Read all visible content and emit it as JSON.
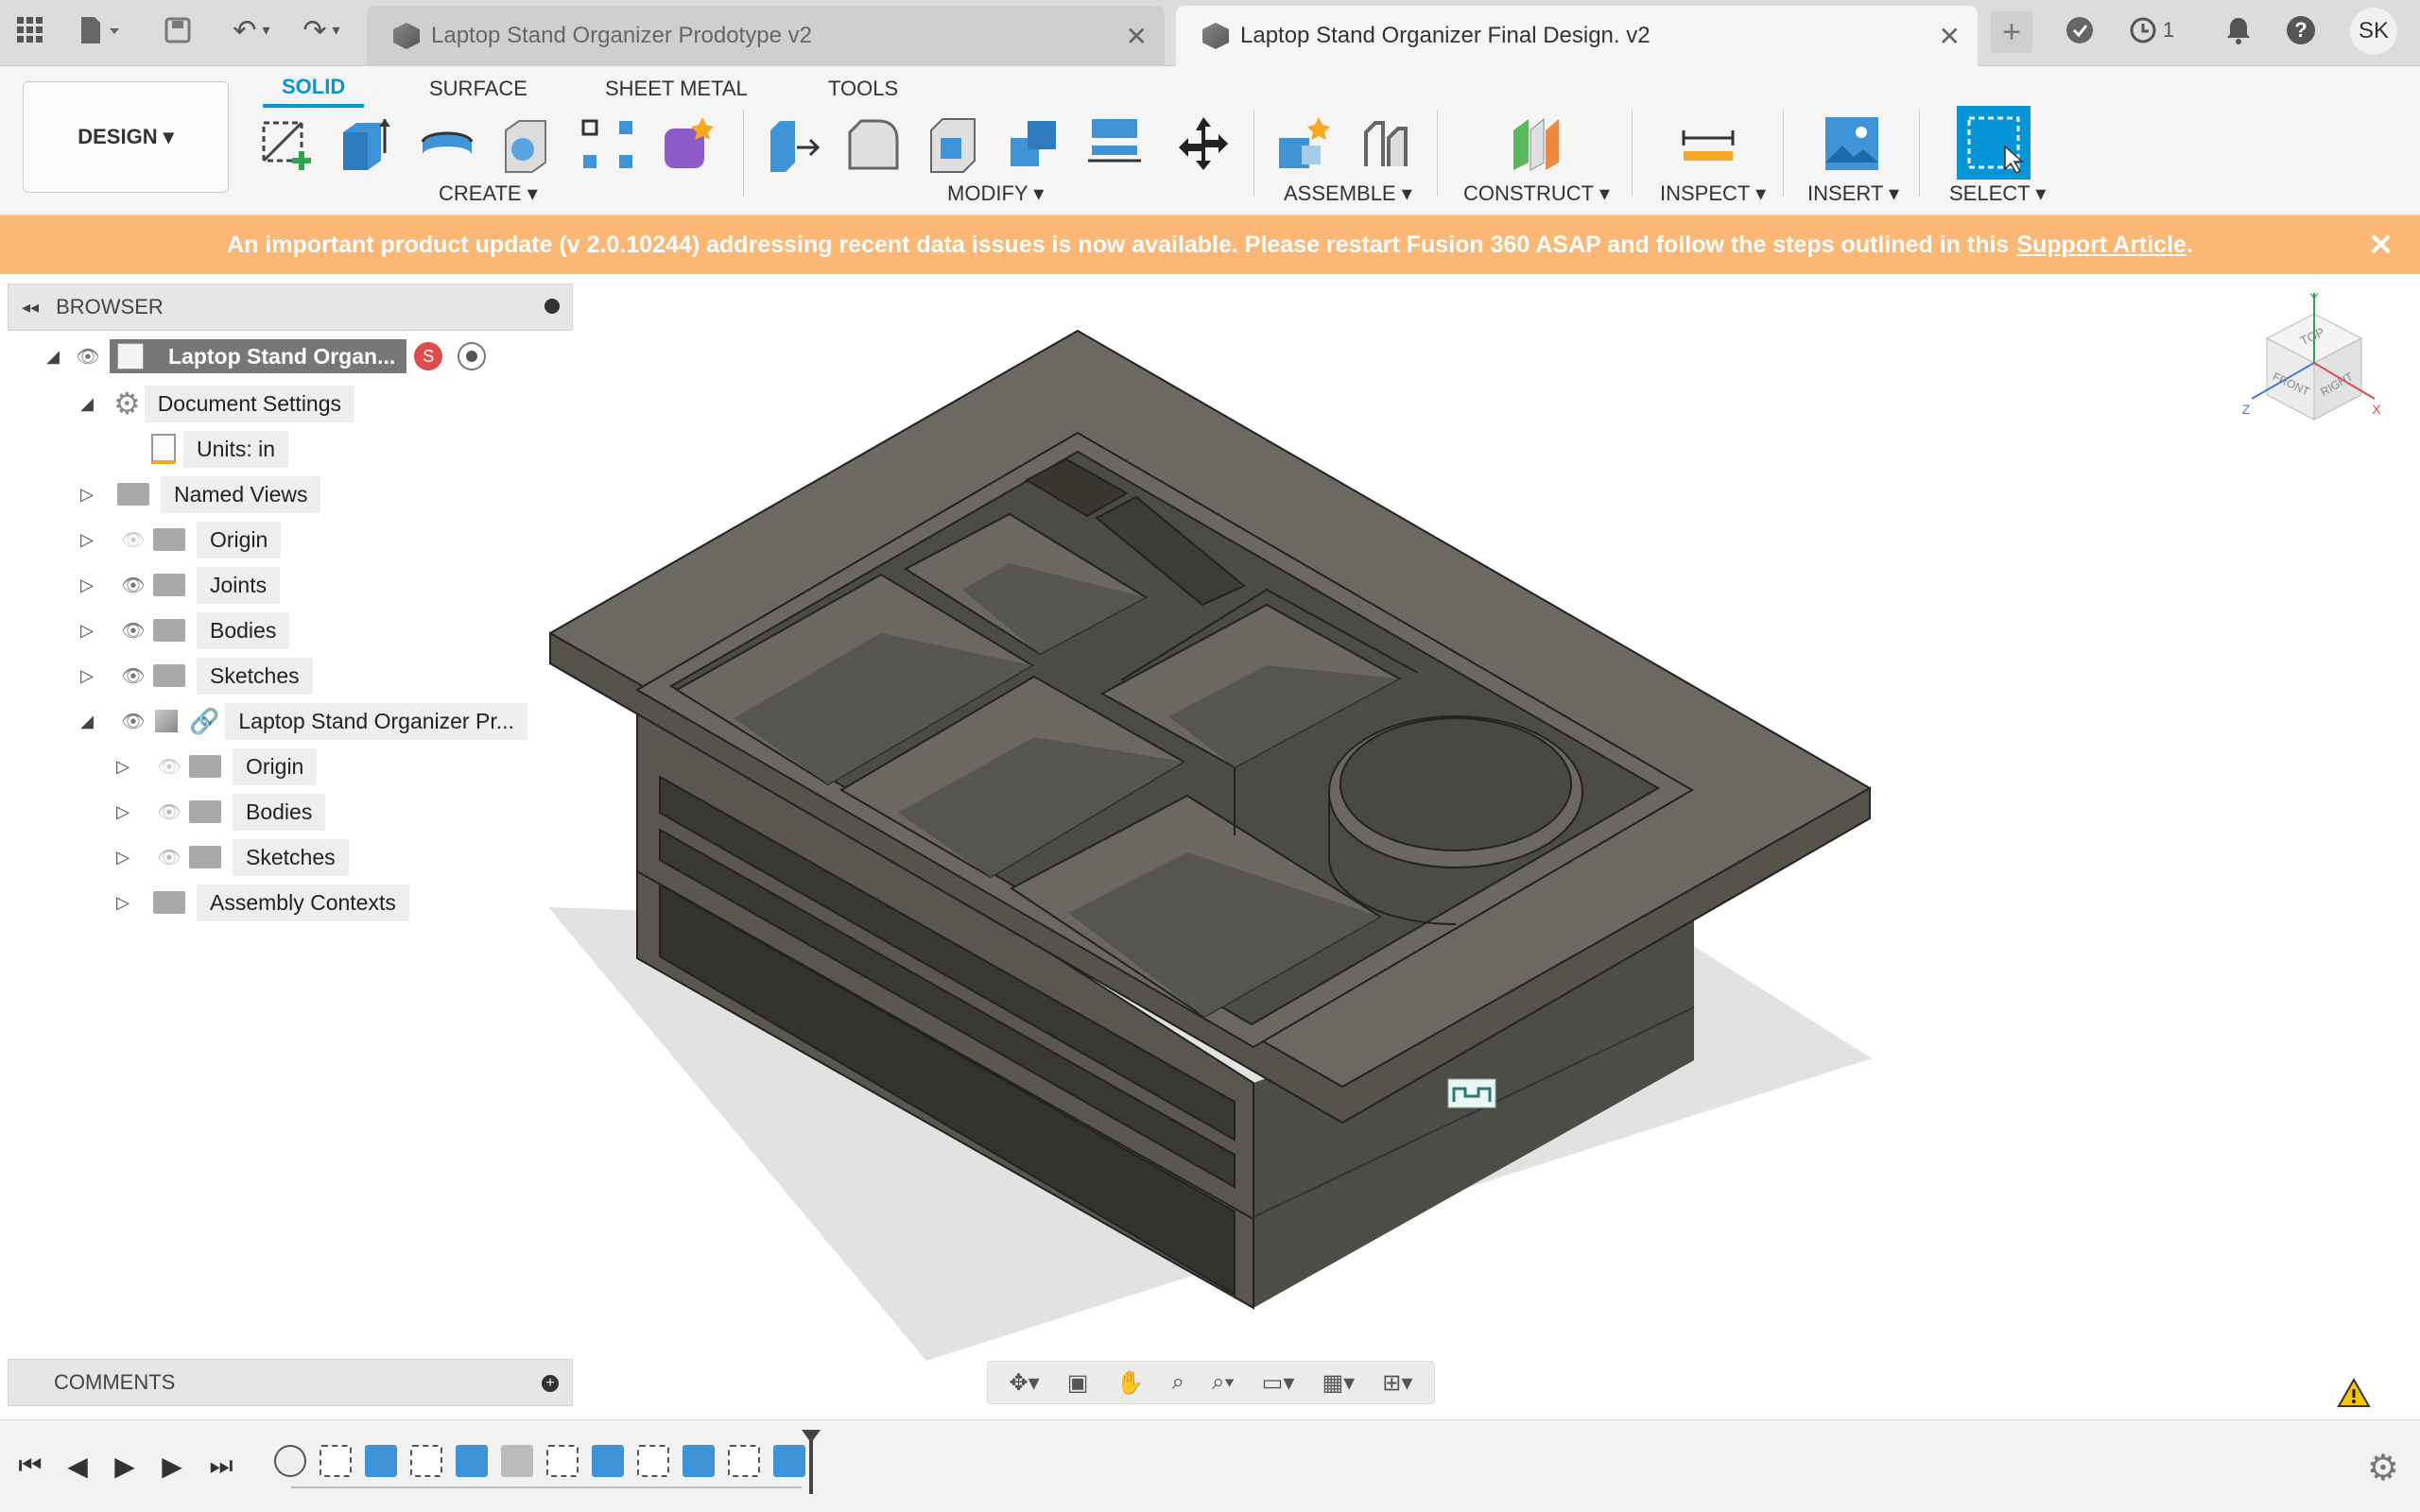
{
  "tabs": [
    {
      "label": "Laptop Stand Organizer Prodotype v2",
      "active": false
    },
    {
      "label": "Laptop Stand Organizer Final Design. v2",
      "active": true
    }
  ],
  "topbar": {
    "jobs_count": "1",
    "user_initials": "SK"
  },
  "workspace": {
    "design_label": "DESIGN ▾",
    "tabs": [
      "SOLID",
      "SURFACE",
      "SHEET METAL",
      "TOOLS"
    ]
  },
  "groups": {
    "create": "CREATE ▾",
    "modify": "MODIFY ▾",
    "assemble": "ASSEMBLE ▾",
    "construct": "CONSTRUCT ▾",
    "inspect": "INSPECT ▾",
    "insert": "INSERT ▾",
    "select": "SELECT ▾"
  },
  "banner": {
    "text": "An important product update (v 2.0.10244) addressing recent data issues is now available. Please restart Fusion 360 ASAP and follow the steps outlined in this",
    "link": "Support Article",
    "suffix": "."
  },
  "browser": {
    "title": "BROWSER",
    "root": "Laptop Stand Organ...",
    "doc_settings": "Document Settings",
    "units": "Units: in",
    "named_views": "Named Views",
    "origin": "Origin",
    "joints": "Joints",
    "bodies": "Bodies",
    "sketches": "Sketches",
    "component": "Laptop Stand Organizer Pr...",
    "sub_origin": "Origin",
    "sub_bodies": "Bodies",
    "sub_sketches": "Sketches",
    "assembly_contexts": "Assembly Contexts"
  },
  "comments": {
    "title": "COMMENTS"
  },
  "viewcube": {
    "top": "TOP",
    "front": "FRONT",
    "right": "RIGHT",
    "x": "X",
    "y": "Y",
    "z": "Z"
  },
  "colors": {
    "accent": "#0696d7",
    "banner": "#fbb775",
    "model": "#6b6962"
  }
}
